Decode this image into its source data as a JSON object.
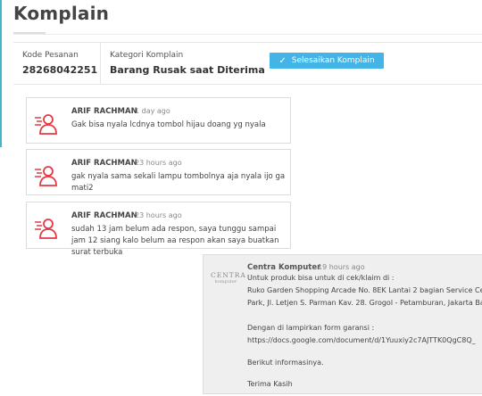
{
  "page": {
    "title": "Komplain"
  },
  "info": {
    "order_code_label": "Kode Pesanan",
    "order_code": "28268042251",
    "category_label": "Kategori Komplain",
    "category": "Barang Rusak saat Diterima",
    "resolve_button": "Selesaikan Komplain",
    "resolve_icon": "check-icon"
  },
  "colors": {
    "accent": "#42b4e6",
    "avatar": "#e53945",
    "agent_bg": "#efefef"
  },
  "messages": [
    {
      "author": "ARIF RACHMAN",
      "time": "1 day ago",
      "text": "Gak bisa nyala lcdnya tombol hijau doang yg nyala"
    },
    {
      "author": "ARIF RACHMAN",
      "time": "23 hours ago",
      "text": "gak nyala sama sekali lampu tombolnya aja nyala ijo ga mati2"
    },
    {
      "author": "ARIF RACHMAN",
      "time": "23 hours ago",
      "text": "sudah 13 jam belum ada respon, saya tunggu sampai jam 12 siang kalo belum aa respon akan saya buatkan surat terbuka"
    }
  ],
  "agent": {
    "logo_main": "CENTRA",
    "logo_sub": "komputer",
    "author": "Centra Komputer",
    "time": "19 hours ago",
    "lines": [
      "Untuk produk bisa untuk di cek/klaim di :",
      "Ruko Garden Shopping Arcade No. 8EK Lantai 2 bagian Service Cer",
      "Park, Jl. Letjen S. Parman Kav. 28. Grogol - Petamburan, Jakarta Bar",
      "",
      "Dengan di lampirkan form garansi :",
      "https://docs.google.com/document/d/1Yuuxiy2c7AJTTK0QgC8Q_",
      "",
      "Berikut informasinya.",
      "",
      "Terima Kasih"
    ]
  }
}
